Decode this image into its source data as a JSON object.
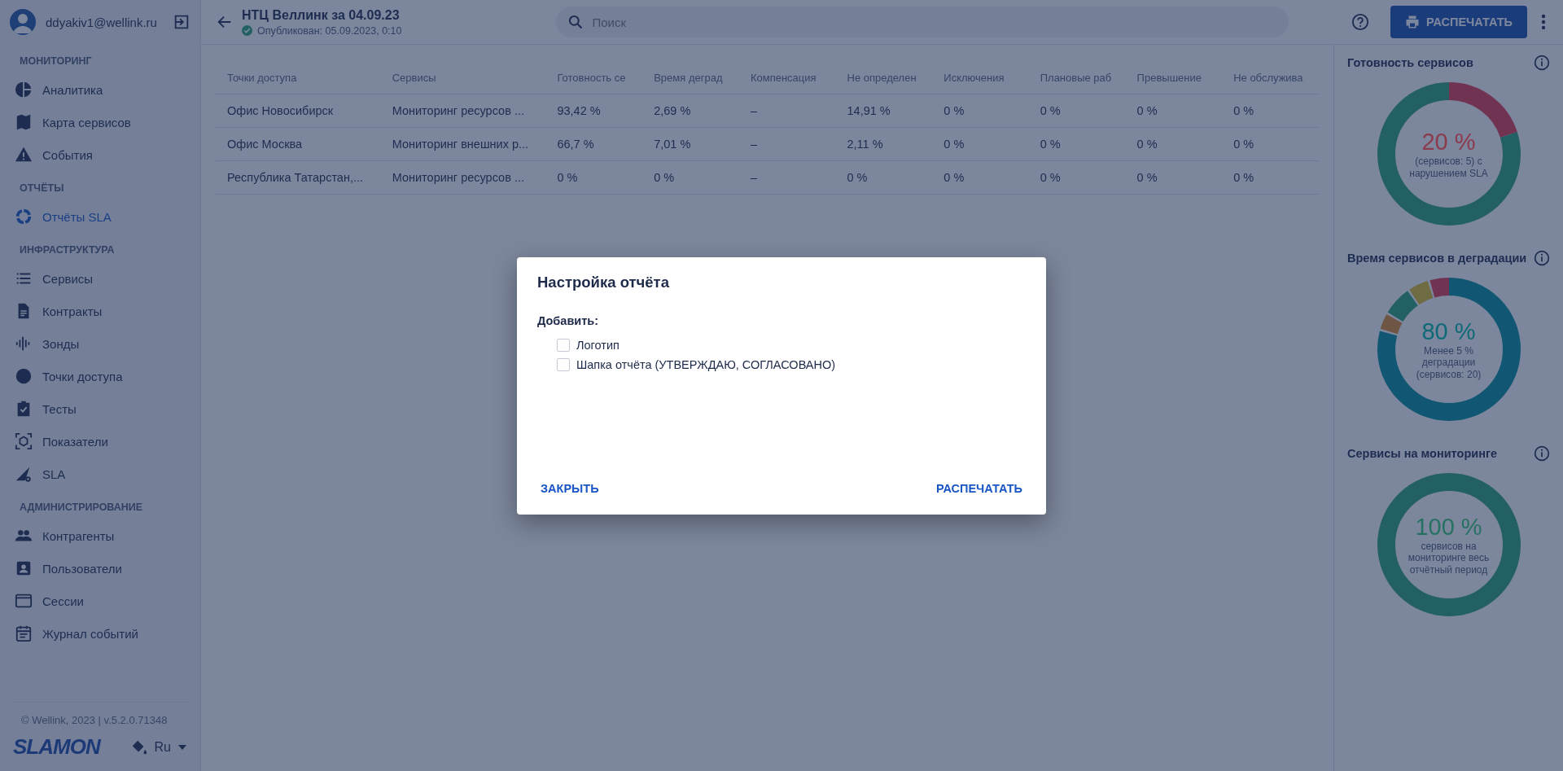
{
  "user": {
    "email": "ddyakiv1@wellink.ru"
  },
  "sidebar": {
    "sections": [
      {
        "title": "МОНИТОРИНГ",
        "items": [
          {
            "label": "Аналитика",
            "selected": false
          },
          {
            "label": "Карта сервисов",
            "selected": false
          },
          {
            "label": "События",
            "selected": false
          }
        ]
      },
      {
        "title": "ОТЧЁТЫ",
        "items": [
          {
            "label": "Отчёты SLA",
            "selected": true
          }
        ]
      },
      {
        "title": "ИНФРАСТРУКТУРА",
        "items": [
          {
            "label": "Сервисы",
            "selected": false
          },
          {
            "label": "Контракты",
            "selected": false
          },
          {
            "label": "Зонды",
            "selected": false
          },
          {
            "label": "Точки доступа",
            "selected": false
          },
          {
            "label": "Тесты",
            "selected": false
          },
          {
            "label": "Показатели",
            "selected": false
          },
          {
            "label": "SLA",
            "selected": false
          }
        ]
      },
      {
        "title": "АДМИНИСТРИРОВАНИЕ",
        "items": [
          {
            "label": "Контрагенты",
            "selected": false
          },
          {
            "label": "Пользователи",
            "selected": false
          },
          {
            "label": "Сессии",
            "selected": false
          },
          {
            "label": "Журнал событий",
            "selected": false
          }
        ]
      }
    ]
  },
  "footer": {
    "copyright": "© Wellink, 2023 | v.5.2.0.71348",
    "logo": "SLAMON",
    "language": "Ru"
  },
  "header": {
    "title": "НТЦ Веллинк за 04.09.23",
    "status": "Опубликован: 05.09.2023, 0:10",
    "search": {
      "placeholder": "Поиск"
    },
    "print_button": "РАСПЕЧАТАТЬ"
  },
  "table": {
    "columns": [
      "Точки доступа",
      "Сервисы",
      "Готовность се",
      "Время деград",
      "Компенсация",
      "Не определен",
      "Исключения",
      "Плановые раб",
      "Превышение",
      "Не обслужива"
    ],
    "rows": [
      [
        "Офис Новосибирск",
        "Мониторинг ресурсов ...",
        "93,42 %",
        "2,69 %",
        "–",
        "14,91 %",
        "0 %",
        "0 %",
        "0 %",
        "0 %"
      ],
      [
        "Офис Москва",
        "Мониторинг внешних р...",
        "66,7 %",
        "7,01 %",
        "–",
        "2,11 %",
        "0 %",
        "0 %",
        "0 %",
        "0 %"
      ],
      [
        "Республика Татарстан,...",
        "Мониторинг ресурсов ...",
        "0 %",
        "0 %",
        "–",
        "0 %",
        "0 %",
        "0 %",
        "0 %",
        "0 %"
      ]
    ]
  },
  "widgets": [
    {
      "title": "Готовность сервисов",
      "value": "20 %",
      "caption": "(сервисов: 5) с нарушением SLA",
      "color": "#8c3a4d"
    },
    {
      "title": "Время сервисов в деградации",
      "value": "80 %",
      "caption": "Менее 5 % деградации (сервисов: 20)",
      "color": "#0d6b78"
    },
    {
      "title": "Сервисы на мониторинге",
      "value": "100 %",
      "caption": "сервисов на мониторинге весь отчётный период",
      "color": "#267262"
    }
  ],
  "dialog": {
    "title": "Настройка отчёта",
    "label": "Добавить:",
    "options": [
      {
        "label": "Логотип",
        "checked": false
      },
      {
        "label": "Шапка отчёта (УТВЕРЖДАЮ, СОГЛАСОВАНО)",
        "checked": false
      }
    ],
    "close_button": "ЗАКРЫТЬ",
    "confirm_button": "РАСПЕЧАТАТЬ"
  }
}
